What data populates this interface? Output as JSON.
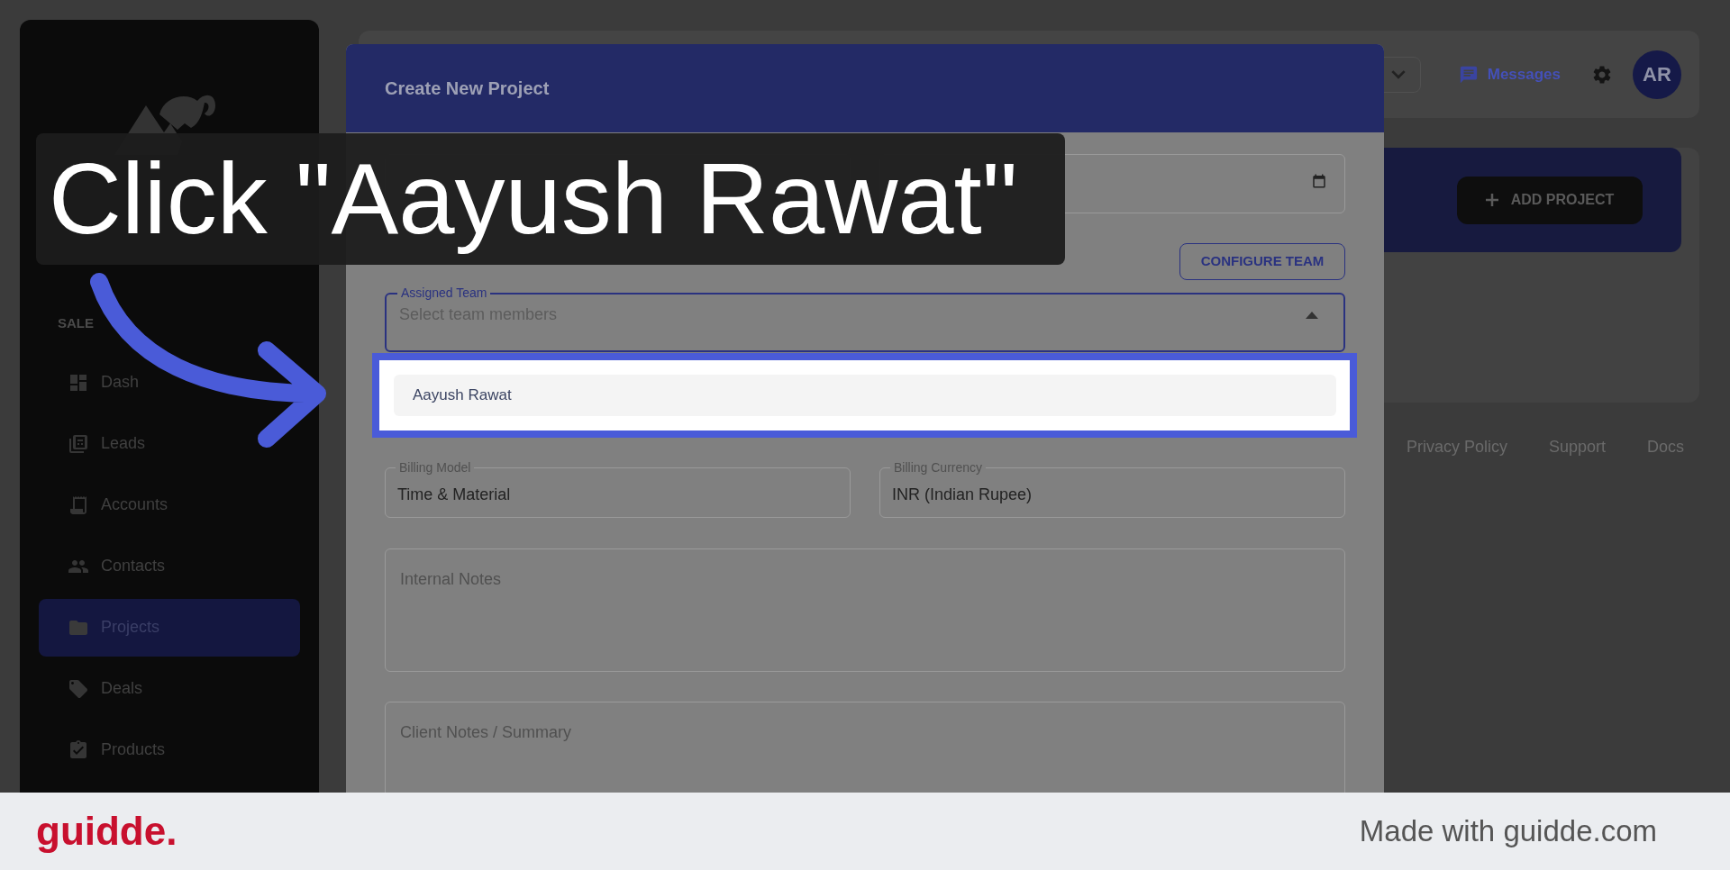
{
  "sidebar": {
    "section": "SALE",
    "items": [
      {
        "label": "Dash",
        "selected": false
      },
      {
        "label": "Leads",
        "selected": false
      },
      {
        "label": "Accounts",
        "selected": false
      },
      {
        "label": "Contacts",
        "selected": false
      },
      {
        "label": "Projects",
        "selected": true
      },
      {
        "label": "Deals",
        "selected": false
      },
      {
        "label": "Products",
        "selected": false
      }
    ]
  },
  "topbar": {
    "messages": "Messages",
    "avatar": "AR"
  },
  "hero": {
    "button": "ADD PROJECT"
  },
  "footer_links": [
    "Privacy Policy",
    "Support",
    "Docs"
  ],
  "modal": {
    "title": "Create New Project",
    "configure_button": "CONFIGURE TEAM",
    "assigned_team": {
      "label": "Assigned Team",
      "placeholder": "Select team members",
      "expanded": true,
      "options": [
        {
          "label": "Aayush Rawat",
          "highlighted": true
        }
      ]
    },
    "billing_fields": [
      {
        "label": "Billing Model",
        "value": "Time & Material"
      },
      {
        "label": "Billing Currency",
        "value": "INR (Indian Rupee)"
      }
    ],
    "notes": [
      {
        "placeholder": "Internal Notes"
      },
      {
        "placeholder": "Client Notes / Summary"
      }
    ]
  },
  "caption": "Click \"Aayush Rawat\"",
  "branding": {
    "logo": "guidde.",
    "credit": "Made with guidde.com"
  }
}
